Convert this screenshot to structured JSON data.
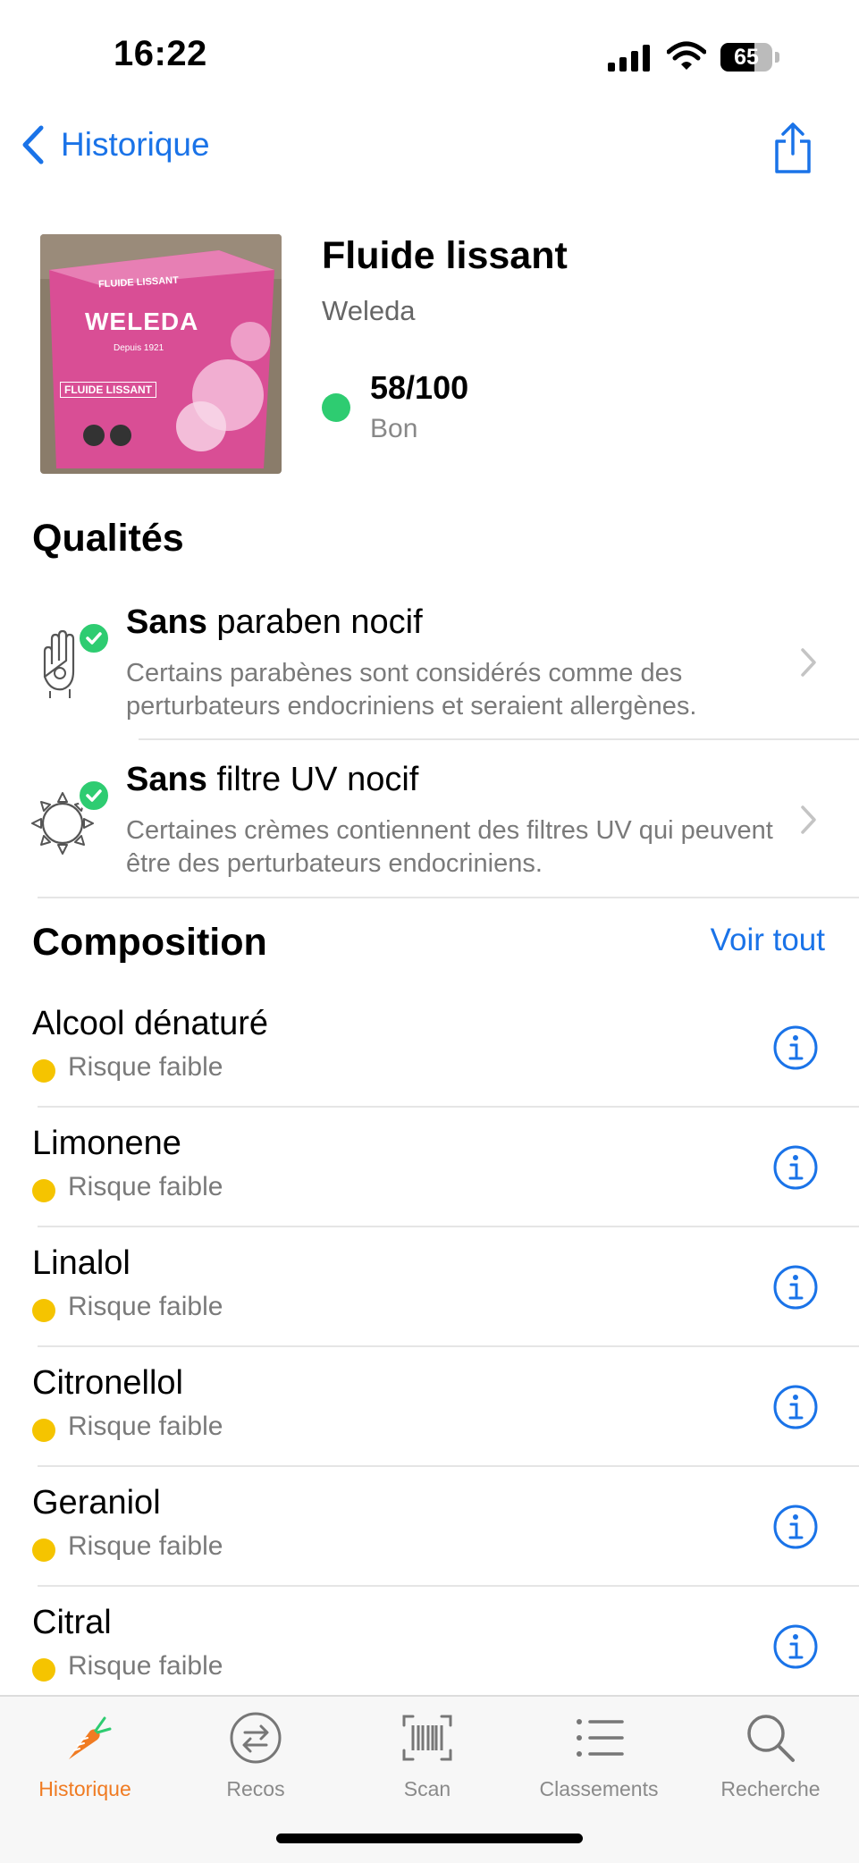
{
  "status_bar": {
    "time": "16:22",
    "battery": "65"
  },
  "nav": {
    "back_label": "Historique"
  },
  "product": {
    "name": "Fluide lissant",
    "brand": "Weleda",
    "score": "58/100",
    "rating": "Bon",
    "rating_color": "#2ecc71",
    "image_text": {
      "top": "FLUIDE LISSANT",
      "logo": "WELEDA",
      "since": "Depuis 1921",
      "label": "FLUIDE LISSANT"
    }
  },
  "qualities": {
    "title": "Qualités",
    "items": [
      {
        "bold": "Sans",
        "rest": " paraben nocif",
        "description": "Certains parabènes sont considérés comme des perturbateurs endocriniens et seraient allergènes.",
        "icon": "hand-icon"
      },
      {
        "bold": "Sans",
        "rest": " filtre UV nocif",
        "description": "Certaines crèmes contiennent des filtres UV qui peuvent être des perturbateurs endocriniens.",
        "icon": "sun-icon"
      }
    ]
  },
  "composition": {
    "title": "Composition",
    "see_all": "Voir tout",
    "risk_color": "#f5c400",
    "items": [
      {
        "name": "Alcool dénaturé",
        "risk": "Risque faible"
      },
      {
        "name": "Limonene",
        "risk": "Risque faible"
      },
      {
        "name": "Linalol",
        "risk": "Risque faible"
      },
      {
        "name": "Citronellol",
        "risk": "Risque faible"
      },
      {
        "name": "Geraniol",
        "risk": "Risque faible"
      },
      {
        "name": "Citral",
        "risk": "Risque faible"
      }
    ]
  },
  "tabbar": {
    "accent": "#f07b22",
    "tabs": [
      {
        "label": "Historique",
        "icon": "carrot-icon",
        "active": true
      },
      {
        "label": "Recos",
        "icon": "swap-icon",
        "active": false
      },
      {
        "label": "Scan",
        "icon": "barcode-icon",
        "active": false
      },
      {
        "label": "Classements",
        "icon": "list-icon",
        "active": false
      },
      {
        "label": "Recherche",
        "icon": "search-icon",
        "active": false
      }
    ]
  }
}
